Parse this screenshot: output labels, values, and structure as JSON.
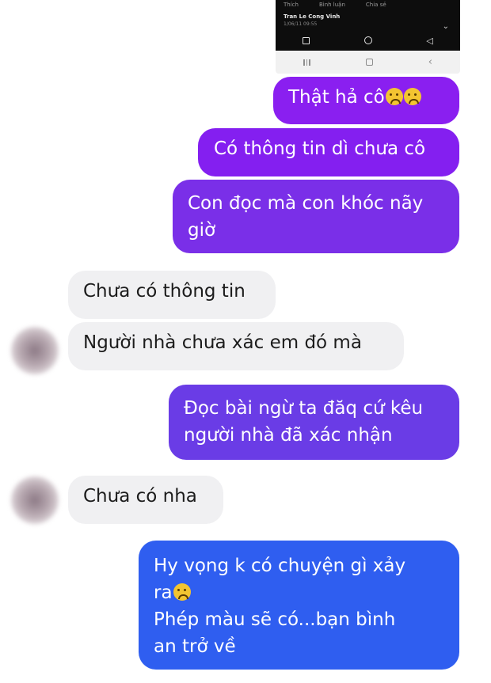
{
  "shared_post": {
    "actions": [
      "Thích",
      "Bình luận",
      "Chia sẻ"
    ],
    "author": "Tran Le Cong Vinh",
    "time": "1/06/11 09:55"
  },
  "messages": [
    {
      "side": "sent",
      "text": "Thật hả cô",
      "emojis": [
        "crying-face",
        "crying-face"
      ]
    },
    {
      "side": "sent",
      "text": "Có thông tin dì chưa cô"
    },
    {
      "side": "sent",
      "lines": [
        "Con đọc mà con khóc nãy",
        "giờ"
      ]
    },
    {
      "side": "received",
      "text": "Chưa có thông tin"
    },
    {
      "side": "received",
      "text": "Người nhà chưa xác em đó mà"
    },
    {
      "side": "sent",
      "lines": [
        "Đọc bài ngừ ta đăq cứ kêu",
        "người nhà đã xác nhận"
      ]
    },
    {
      "side": "received",
      "text": "Chưa có nha"
    },
    {
      "side": "sent",
      "lines": [
        "Hy vọng k có chuyện gì xảy",
        "ra",
        "Phép màu sẽ có...bạn bình",
        "an trở về"
      ],
      "emoji_after_line": 1
    }
  ],
  "colors": {
    "sent_top": "#8a1ff0",
    "sent_mid": "#7a2fe8",
    "sent_lower": "#6a3ce6",
    "sent_bottom": "#2f5ef0",
    "received_bg": "#f0f0f2"
  }
}
